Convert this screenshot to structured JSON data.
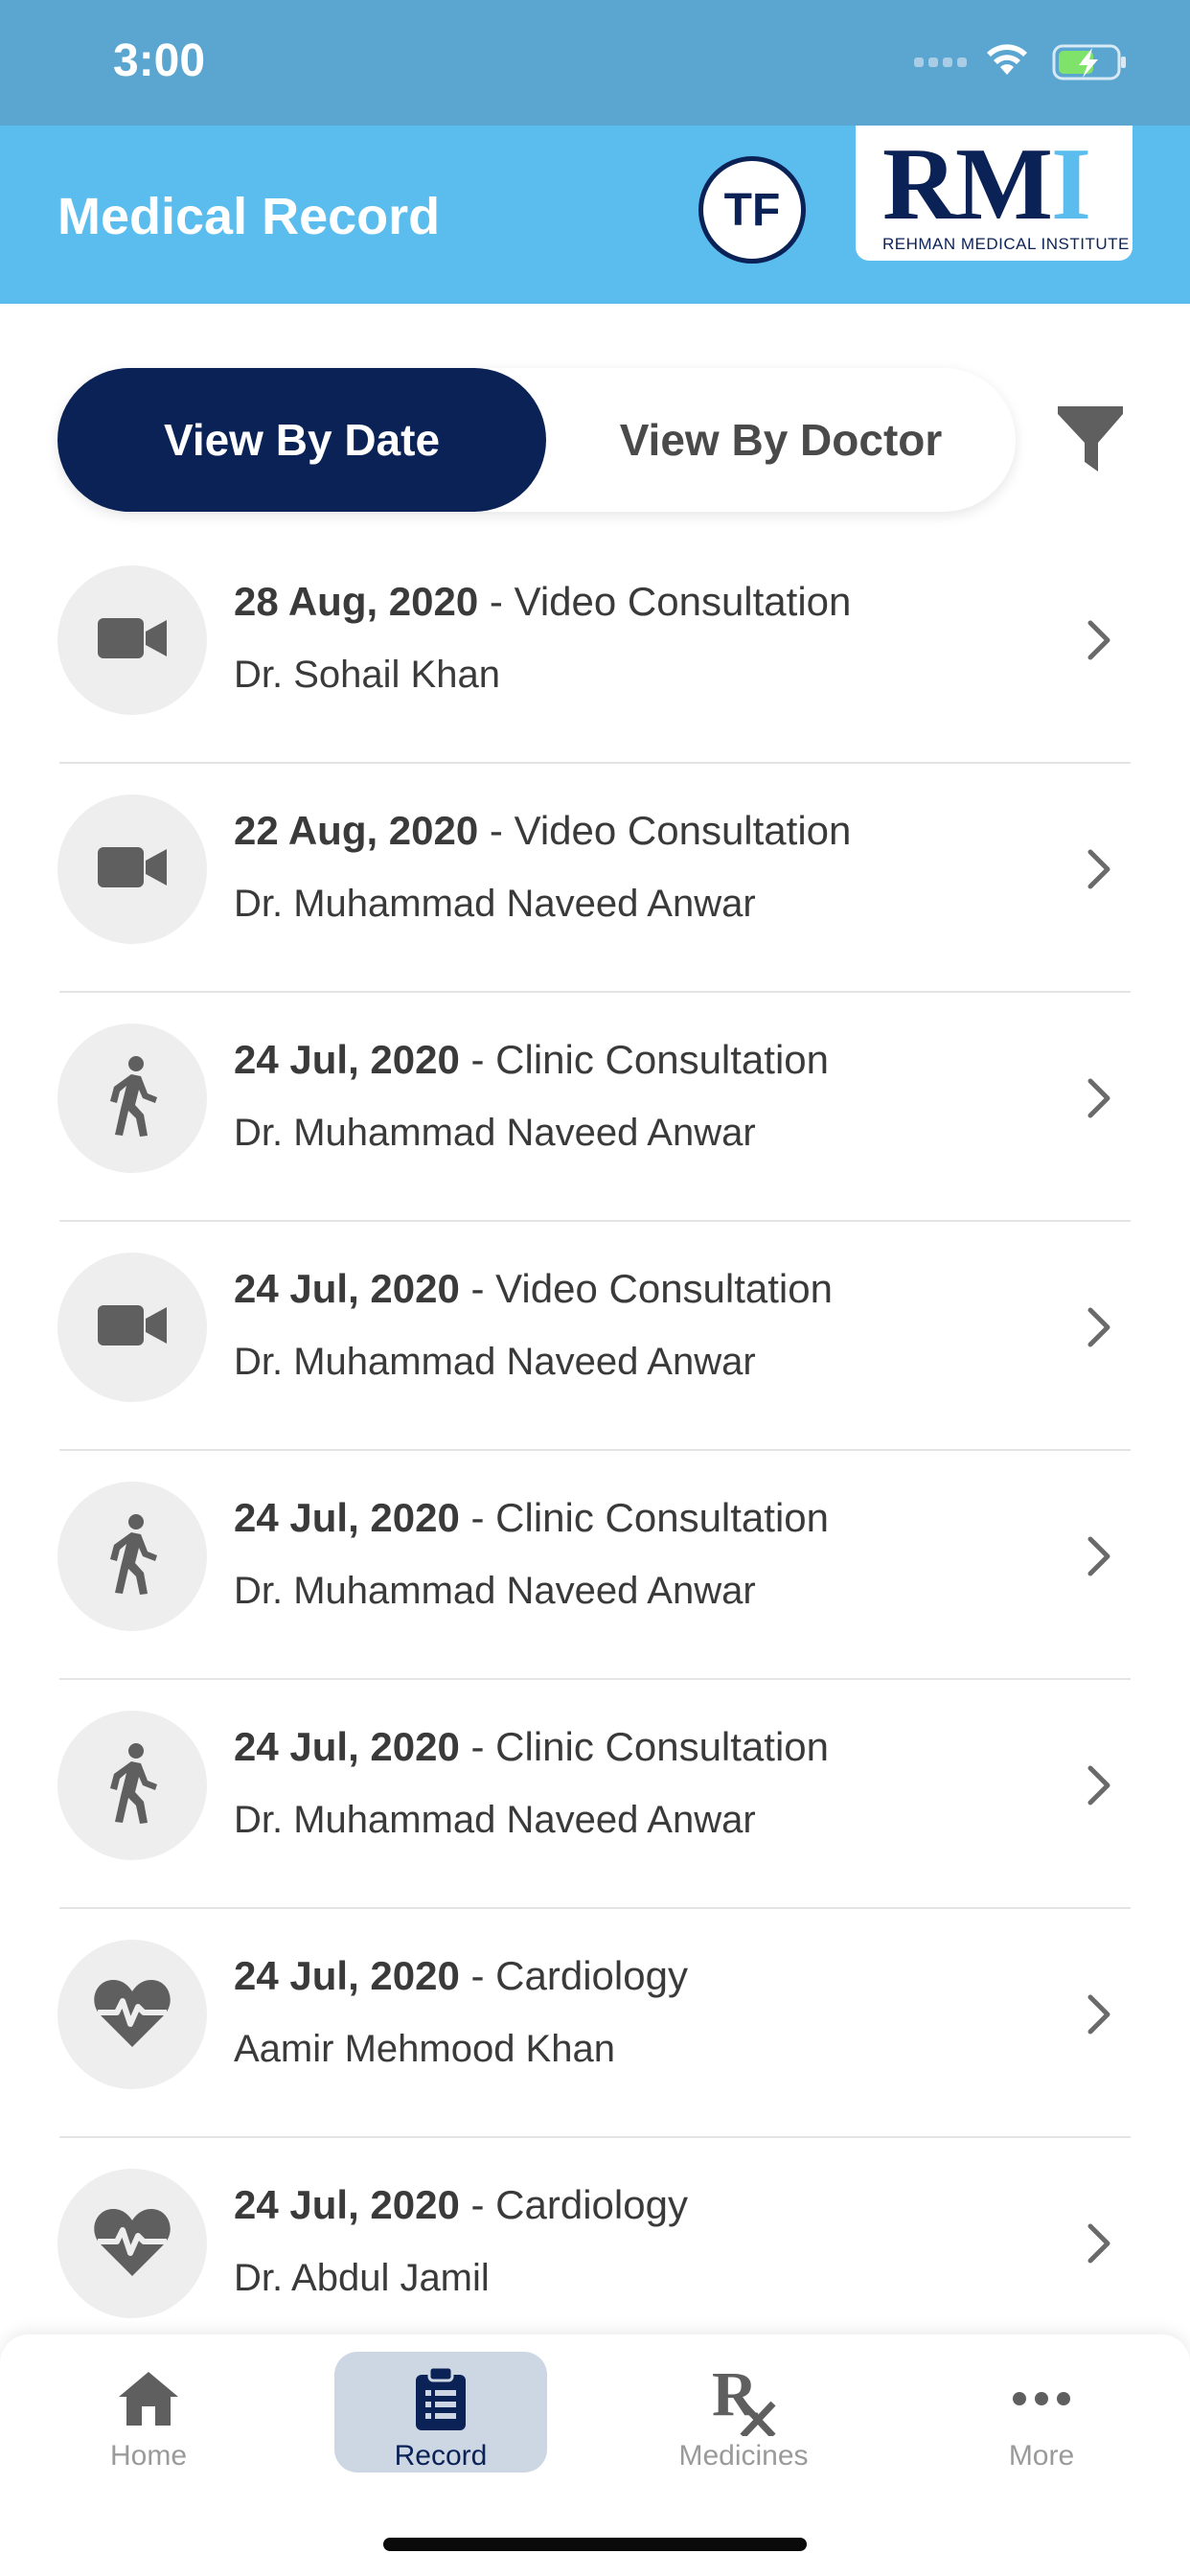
{
  "status_bar": {
    "time": "3:00"
  },
  "header": {
    "title": "Medical Record",
    "avatar_initials": "TF",
    "logo_text": "RMI",
    "logo_subtitle": "REHMAN MEDICAL INSTITUTE"
  },
  "segment": {
    "by_date": "View By Date",
    "by_doctor": "View By Doctor",
    "selected": "View By Date"
  },
  "records": [
    {
      "date": "28 Aug, 2020",
      "type": " - Video Consultation",
      "doctor": "Dr. Sohail  Khan",
      "icon": "video-camera-icon"
    },
    {
      "date": "22 Aug, 2020",
      "type": " - Video Consultation",
      "doctor": "Dr. Muhammad Naveed Anwar",
      "icon": "video-camera-icon"
    },
    {
      "date": "24 Jul, 2020",
      "type": " - Clinic Consultation",
      "doctor": "Dr. Muhammad Naveed Anwar",
      "icon": "walking-person-icon"
    },
    {
      "date": "24 Jul, 2020",
      "type": " - Video Consultation",
      "doctor": "Dr. Muhammad Naveed Anwar",
      "icon": "video-camera-icon"
    },
    {
      "date": "24 Jul, 2020",
      "type": " - Clinic Consultation",
      "doctor": "Dr. Muhammad Naveed Anwar",
      "icon": "walking-person-icon"
    },
    {
      "date": "24 Jul, 2020",
      "type": " - Clinic Consultation",
      "doctor": "Dr. Muhammad Naveed Anwar",
      "icon": "walking-person-icon"
    },
    {
      "date": "24 Jul, 2020",
      "type": " - Cardiology",
      "doctor": "Aamir Mehmood Khan",
      "icon": "heartbeat-icon"
    },
    {
      "date": "24 Jul, 2020",
      "type": " - Cardiology",
      "doctor": "Dr. Abdul  Jamil",
      "icon": "heartbeat-icon"
    }
  ],
  "tab_bar": {
    "home": "Home",
    "record": "Record",
    "medicines": "Medicines",
    "more": "More",
    "active": "Record"
  },
  "colors": {
    "status_bar": "#5aa6d1",
    "header": "#5bbdee",
    "navy": "#0b2257",
    "active_tab_bg": "#cdd6e3",
    "icon_gray": "#5f5f5f"
  }
}
